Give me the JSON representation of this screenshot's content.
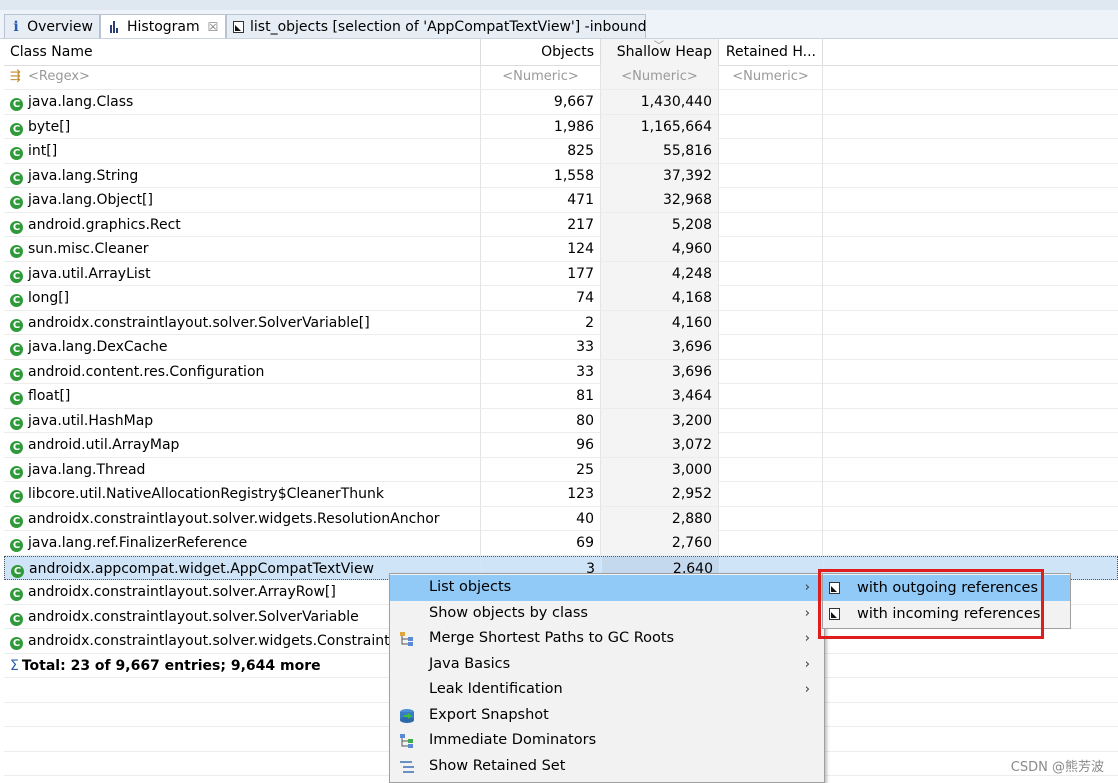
{
  "tabs": [
    {
      "label": "Overview",
      "icon": "info-icon",
      "active": false
    },
    {
      "label": "Histogram",
      "icon": "histogram-icon",
      "active": true,
      "close": "☒"
    },
    {
      "label": "list_objects  [selection of 'AppCompatTextView'] -inbound",
      "icon": "document-icon",
      "active": false
    }
  ],
  "table": {
    "columns": [
      "Class Name",
      "Objects",
      "Shallow Heap",
      "Retained H..."
    ],
    "filters": [
      "<Regex>",
      "<Numeric>",
      "<Numeric>",
      "<Numeric>"
    ],
    "rows": [
      {
        "name": "java.lang.Class",
        "objects": "9,667",
        "shallow": "1,430,440"
      },
      {
        "name": "byte[]",
        "objects": "1,986",
        "shallow": "1,165,664"
      },
      {
        "name": "int[]",
        "objects": "825",
        "shallow": "55,816"
      },
      {
        "name": "java.lang.String",
        "objects": "1,558",
        "shallow": "37,392"
      },
      {
        "name": "java.lang.Object[]",
        "objects": "471",
        "shallow": "32,968"
      },
      {
        "name": "android.graphics.Rect",
        "objects": "217",
        "shallow": "5,208"
      },
      {
        "name": "sun.misc.Cleaner",
        "objects": "124",
        "shallow": "4,960"
      },
      {
        "name": "java.util.ArrayList",
        "objects": "177",
        "shallow": "4,248"
      },
      {
        "name": "long[]",
        "objects": "74",
        "shallow": "4,168"
      },
      {
        "name": "androidx.constraintlayout.solver.SolverVariable[]",
        "objects": "2",
        "shallow": "4,160"
      },
      {
        "name": "java.lang.DexCache",
        "objects": "33",
        "shallow": "3,696"
      },
      {
        "name": "android.content.res.Configuration",
        "objects": "33",
        "shallow": "3,696"
      },
      {
        "name": "float[]",
        "objects": "81",
        "shallow": "3,464"
      },
      {
        "name": "java.util.HashMap",
        "objects": "80",
        "shallow": "3,200"
      },
      {
        "name": "android.util.ArrayMap",
        "objects": "96",
        "shallow": "3,072"
      },
      {
        "name": "java.lang.Thread",
        "objects": "25",
        "shallow": "3,000"
      },
      {
        "name": "libcore.util.NativeAllocationRegistry$CleanerThunk",
        "objects": "123",
        "shallow": "2,952"
      },
      {
        "name": "androidx.constraintlayout.solver.widgets.ResolutionAnchor",
        "objects": "40",
        "shallow": "2,880"
      },
      {
        "name": "java.lang.ref.FinalizerReference",
        "objects": "69",
        "shallow": "2,760"
      },
      {
        "name": "androidx.appcompat.widget.AppCompatTextView",
        "objects": "3",
        "shallow": "2,640",
        "selected": true
      },
      {
        "name": "androidx.constraintlayout.solver.ArrayRow[]",
        "objects": "",
        "shallow": ""
      },
      {
        "name": "androidx.constraintlayout.solver.SolverVariable",
        "objects": "",
        "shallow": ""
      },
      {
        "name": "androidx.constraintlayout.solver.widgets.ConstraintAnchor",
        "objects": "",
        "shallow": ""
      }
    ],
    "total": "Total: 23 of 9,667 entries; 9,644 more"
  },
  "context_menu": {
    "items": [
      {
        "label": "List objects",
        "submenu": true,
        "highlighted": true,
        "icon": ""
      },
      {
        "label": "Show objects by class",
        "submenu": true,
        "icon": ""
      },
      {
        "label": "Merge Shortest Paths to GC Roots",
        "submenu": true,
        "icon": "tree-icon"
      },
      {
        "label": "Java Basics",
        "submenu": true,
        "icon": ""
      },
      {
        "label": "Leak Identification",
        "submenu": true,
        "icon": ""
      },
      {
        "label": "Export Snapshot",
        "submenu": false,
        "icon": "export-snapshot-icon"
      },
      {
        "label": "Immediate Dominators",
        "submenu": false,
        "icon": "dominators-icon"
      },
      {
        "label": "Show Retained Set",
        "submenu": false,
        "icon": "retained-set-icon"
      }
    ],
    "arrow": "›"
  },
  "submenu": {
    "items": [
      {
        "label": "with outgoing references",
        "highlighted": true
      },
      {
        "label": "with incoming references",
        "highlighted": false
      }
    ]
  },
  "colors": {
    "highlight": "#91c9f7",
    "selected_row": "#cfe4f7",
    "class_icon": "#2f9a3a",
    "annotation_box": "#e01d1d"
  },
  "watermark": "CSDN @熊芳波"
}
